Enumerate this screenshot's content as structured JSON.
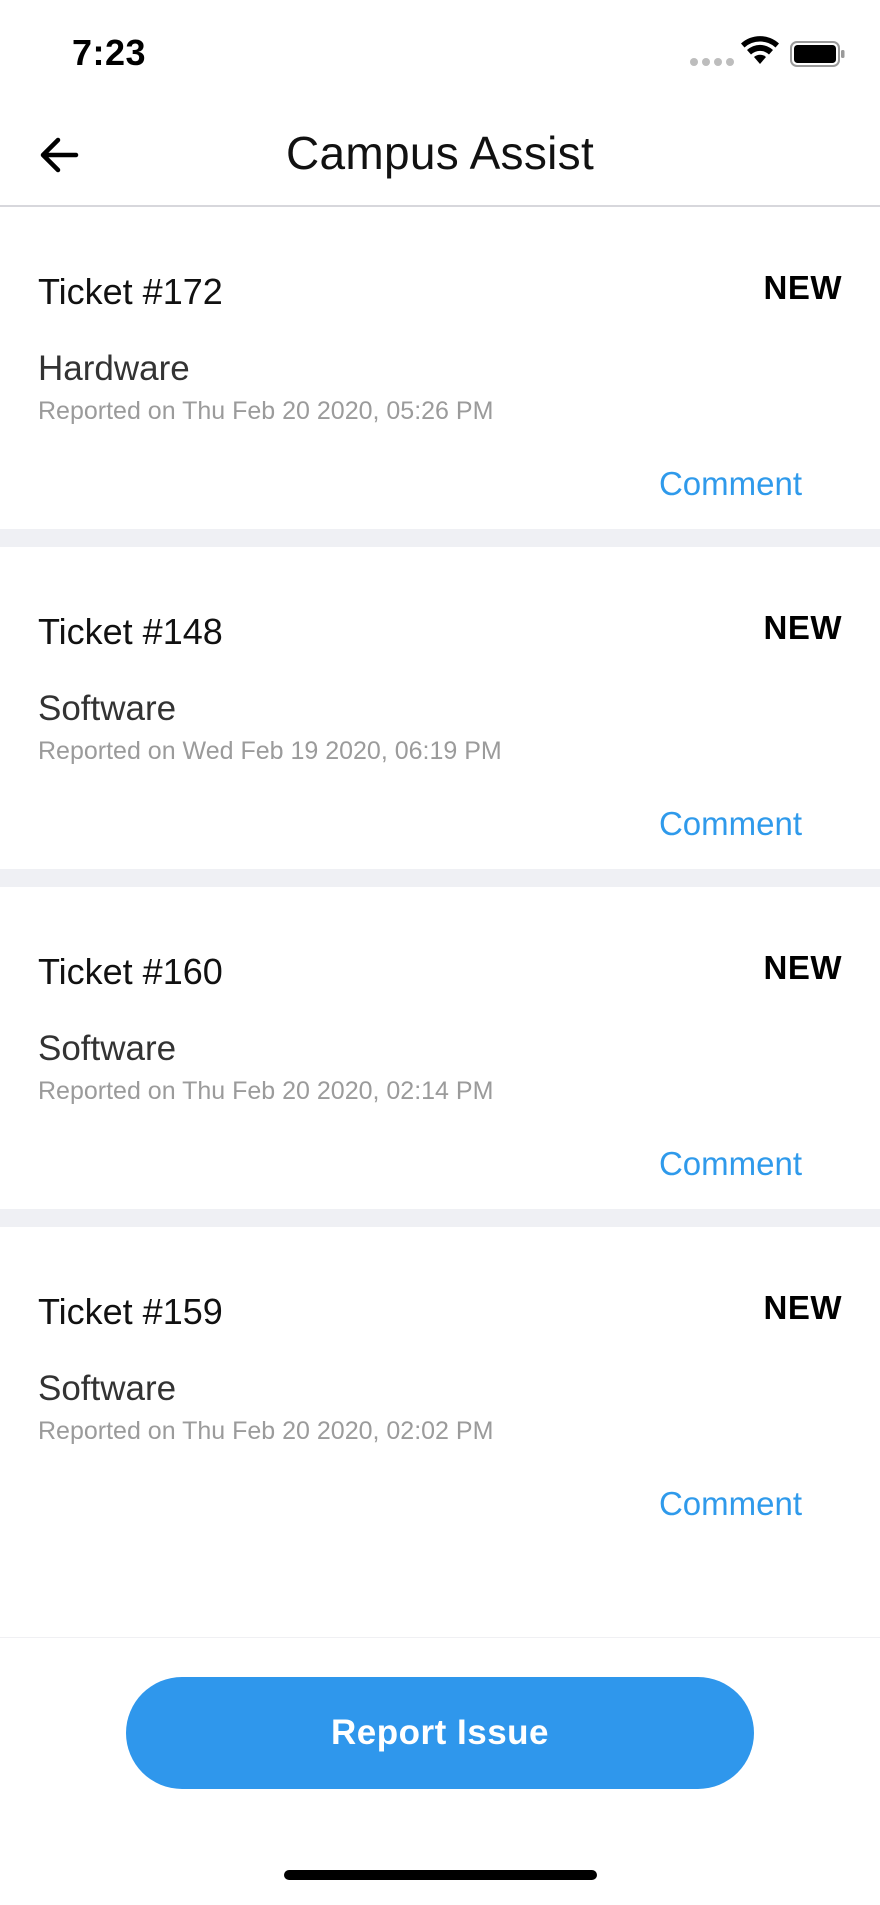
{
  "status_bar": {
    "time": "7:23",
    "icons": [
      "signal-dots-icon",
      "wifi-icon",
      "battery-icon"
    ]
  },
  "nav": {
    "back_icon": "arrow-left-icon",
    "title": "Campus Assist"
  },
  "tickets": [
    {
      "number": "Ticket #172",
      "status": "NEW",
      "category": "Hardware",
      "reported": "Reported on Thu Feb 20 2020, 05:26 PM",
      "action": "Comment"
    },
    {
      "number": "Ticket #148",
      "status": "NEW",
      "category": "Software",
      "reported": "Reported on Wed Feb 19 2020, 06:19 PM",
      "action": "Comment"
    },
    {
      "number": "Ticket #160",
      "status": "NEW",
      "category": "Software",
      "reported": "Reported on Thu Feb 20 2020, 02:14 PM",
      "action": "Comment"
    },
    {
      "number": "Ticket #159",
      "status": "NEW",
      "category": "Software",
      "reported": "Reported on Thu Feb 20 2020, 02:02 PM",
      "action": "Comment"
    }
  ],
  "footer": {
    "report_button": "Report Issue"
  },
  "colors": {
    "accent": "#2f97ec",
    "link": "#2f9aeb",
    "separator": "#eff0f4",
    "muted_text": "#9b9b9b"
  }
}
